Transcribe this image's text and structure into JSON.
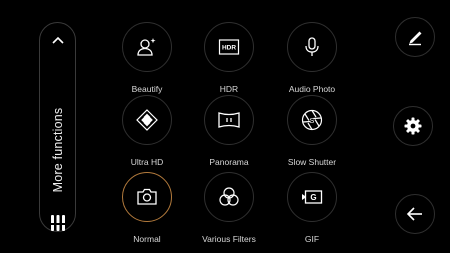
{
  "side_panel": {
    "title": "More functions",
    "icons": {
      "collapse": "chevron-up-icon",
      "grid": "bars-grid-icon"
    }
  },
  "modes": [
    {
      "label": "Beautify",
      "icon": "beautify-icon",
      "selected": false
    },
    {
      "label": "HDR",
      "icon": "hdr-icon",
      "selected": false
    },
    {
      "label": "Audio Photo",
      "icon": "microphone-icon",
      "selected": false
    },
    {
      "label": "Ultra HD",
      "icon": "ultra-hd-icon",
      "selected": false
    },
    {
      "label": "Panorama",
      "icon": "panorama-icon",
      "selected": false
    },
    {
      "label": "Slow Shutter",
      "icon": "slow-shutter-icon",
      "selected": false
    },
    {
      "label": "Normal",
      "icon": "camera-icon",
      "selected": true
    },
    {
      "label": "Various Filters",
      "icon": "filters-icon",
      "selected": false
    },
    {
      "label": "GIF",
      "icon": "gif-icon",
      "selected": false
    }
  ],
  "icon_text": {
    "hdr": "HDR",
    "gif": "G"
  },
  "right_controls": {
    "edit": "pencil-icon",
    "settings": "gear-icon",
    "back": "arrow-left-icon"
  },
  "colors": {
    "accent": "#b27a3c",
    "background": "#000000"
  }
}
